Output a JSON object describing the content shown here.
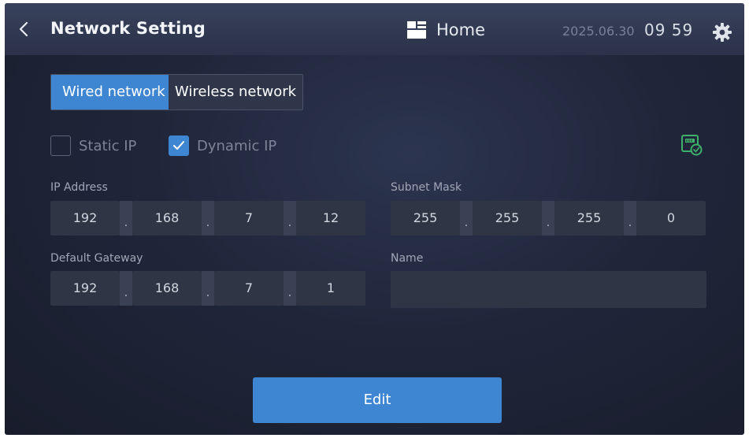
{
  "header": {
    "title": "Network Setting",
    "home_label": "Home",
    "date": "2025.06.30",
    "time": "09 59"
  },
  "tabs": [
    {
      "label": "Wired network",
      "active": true
    },
    {
      "label": "Wireless network",
      "active": false
    }
  ],
  "ip_mode": {
    "static_label": "Static IP",
    "static_checked": false,
    "dynamic_label": "Dynamic IP",
    "dynamic_checked": true
  },
  "fields": {
    "ip_address": {
      "label": "IP Address",
      "octets": [
        "192",
        "168",
        "7",
        "12"
      ]
    },
    "subnet_mask": {
      "label": "Subnet Mask",
      "octets": [
        "255",
        "255",
        "255",
        "0"
      ]
    },
    "default_gateway": {
      "label": "Default Gateway",
      "octets": [
        "192",
        "168",
        "7",
        "1"
      ]
    },
    "name": {
      "label": "Name",
      "value": ""
    }
  },
  "separator": ".",
  "edit_label": "Edit",
  "colors": {
    "accent": "#3f86d2",
    "background": "#20263a",
    "topbar": "#333b53",
    "field": "#2f3545"
  },
  "icons": {
    "back": "chevron-left-icon",
    "home": "home-layout-icon",
    "settings": "gear-icon",
    "network_status": "network-status-icon"
  }
}
